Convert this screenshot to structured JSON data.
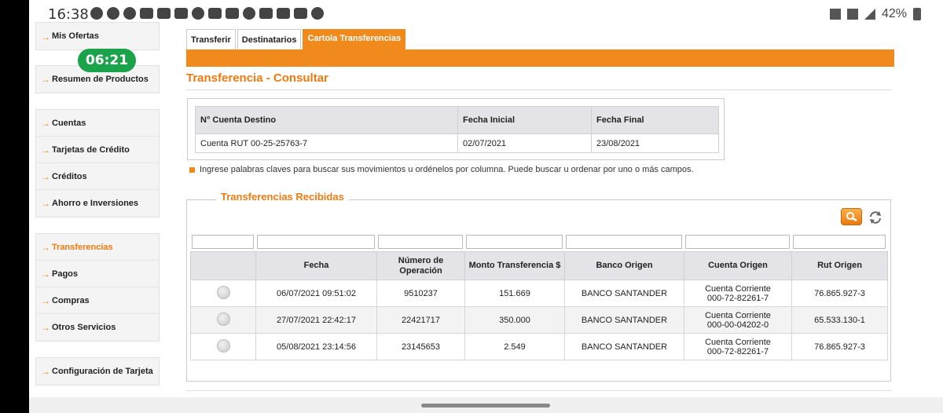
{
  "status_bar": {
    "time": "16:38",
    "battery": "42%"
  },
  "timer": "06:21",
  "sidebar": {
    "arrow": "→",
    "groups": [
      [
        "Mis Ofertas"
      ],
      [
        "Resumen de Productos"
      ],
      [
        "Cuentas",
        "Tarjetas de Crédito",
        "Créditos",
        "Ahorro e Inversiones"
      ],
      [
        "Transferencias",
        "Pagos",
        "Compras",
        "Otros Servicios"
      ],
      [
        "Configuración de Tarjeta"
      ]
    ],
    "active": "Transferencias"
  },
  "tabs": [
    "Transferir",
    "Destinatarios",
    "Cartola Transferencias"
  ],
  "active_tab": "Cartola Transferencias",
  "page_title": "Transferencia - Consultar",
  "account_table": {
    "headers": [
      "N° Cuenta Destino",
      "Fecha Inicial",
      "Fecha Final"
    ],
    "row": [
      "Cuenta RUT  00-25-25763-7",
      "02/07/2021",
      "23/08/2021"
    ]
  },
  "hint": "Ingrese palabras claves para buscar sus movimientos u ordénelos por columna. Puede buscar u ordenar por uno o más campos.",
  "received": {
    "legend": "Transferencias Recibidas",
    "headers": [
      "",
      "Fecha",
      "Número de Operación",
      "Monto Transferencia $",
      "Banco Origen",
      "Cuenta Origen",
      "Rut Origen"
    ],
    "rows": [
      {
        "fecha": "06/07/2021 09:51:02",
        "operacion": "9510237",
        "monto": "151.669",
        "banco": "BANCO SANTANDER",
        "cuenta_tipo": "Cuenta Corriente",
        "cuenta_num": "000-72-82261-7",
        "rut": "76.865.927-3"
      },
      {
        "fecha": "27/07/2021 22:42:17",
        "operacion": "22421717",
        "monto": "350.000",
        "banco": "BANCO SANTANDER",
        "cuenta_tipo": "Cuenta Corriente",
        "cuenta_num": "000-00-04202-0",
        "rut": "65.533.130-1"
      },
      {
        "fecha": "05/08/2021 23:14:56",
        "operacion": "23145653",
        "monto": "2.549",
        "banco": "BANCO SANTANDER",
        "cuenta_tipo": "Cuenta Corriente",
        "cuenta_num": "000-72-82261-7",
        "rut": "76.865.927-3"
      }
    ]
  },
  "colors": {
    "accent_orange": "#f08a1c",
    "title_orange": "#f07a10",
    "timer_green": "#1aa34a"
  },
  "icons": {
    "search": "search-icon",
    "refresh": "refresh-icon"
  }
}
